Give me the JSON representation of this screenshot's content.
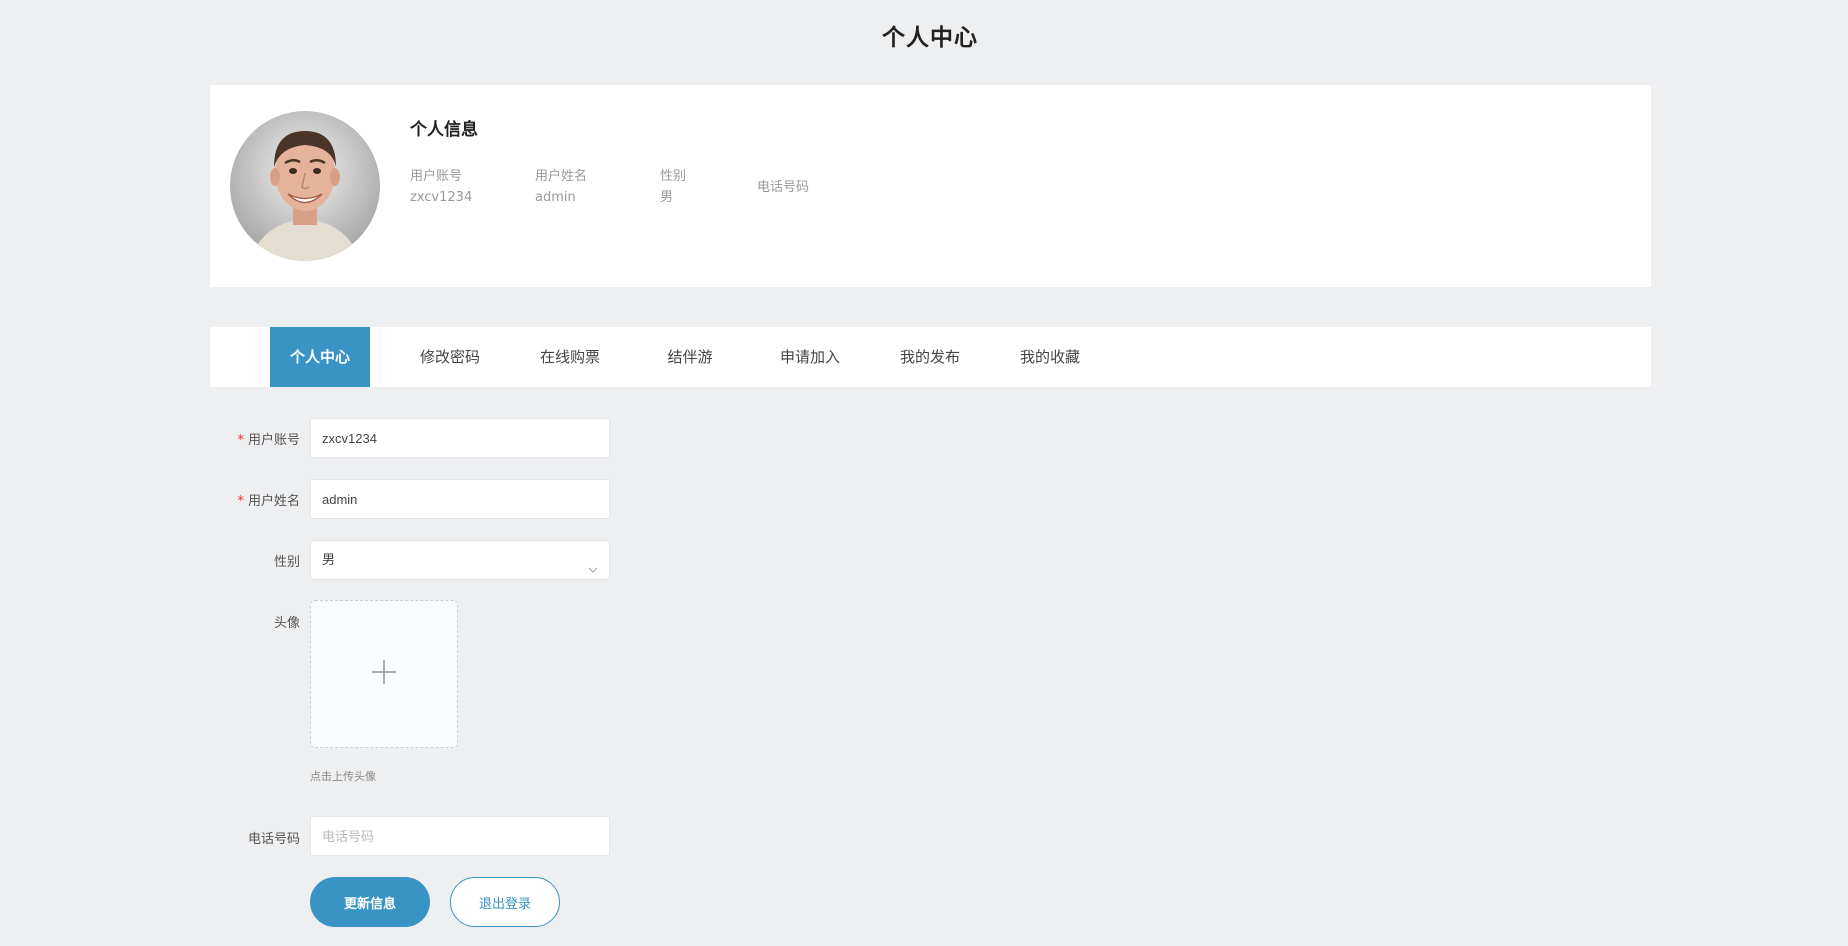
{
  "page_title": "个人中心",
  "profile": {
    "title": "个人信息",
    "fields": [
      {
        "label": "用户账号",
        "value": "zxcv1234"
      },
      {
        "label": "用户姓名",
        "value": "admin"
      },
      {
        "label": "性别",
        "value": "男"
      },
      {
        "label": "电话号码",
        "value": ""
      }
    ]
  },
  "tabs": [
    {
      "label": "个人中心",
      "active": true
    },
    {
      "label": "修改密码",
      "active": false
    },
    {
      "label": "在线购票",
      "active": false
    },
    {
      "label": "结伴游",
      "active": false
    },
    {
      "label": "申请加入",
      "active": false
    },
    {
      "label": "我的发布",
      "active": false
    },
    {
      "label": "我的收藏",
      "active": false
    }
  ],
  "form": {
    "required_mark": "*",
    "account": {
      "label": "用户账号",
      "value": "zxcv1234"
    },
    "name": {
      "label": "用户姓名",
      "value": "admin"
    },
    "gender": {
      "label": "性别",
      "value": "男"
    },
    "avatar": {
      "label": "头像",
      "tip": "点击上传头像"
    },
    "phone": {
      "label": "电话号码",
      "value": "",
      "placeholder": "电话号码"
    }
  },
  "buttons": {
    "update": "更新信息",
    "logout": "退出登录"
  },
  "colors": {
    "accent": "#3a93c5",
    "background": "#eeeff1",
    "required": "#ee3333"
  },
  "icons": {
    "avatar": "user-photo",
    "gender_select": "chevron-down-icon",
    "upload": "plus-icon"
  }
}
